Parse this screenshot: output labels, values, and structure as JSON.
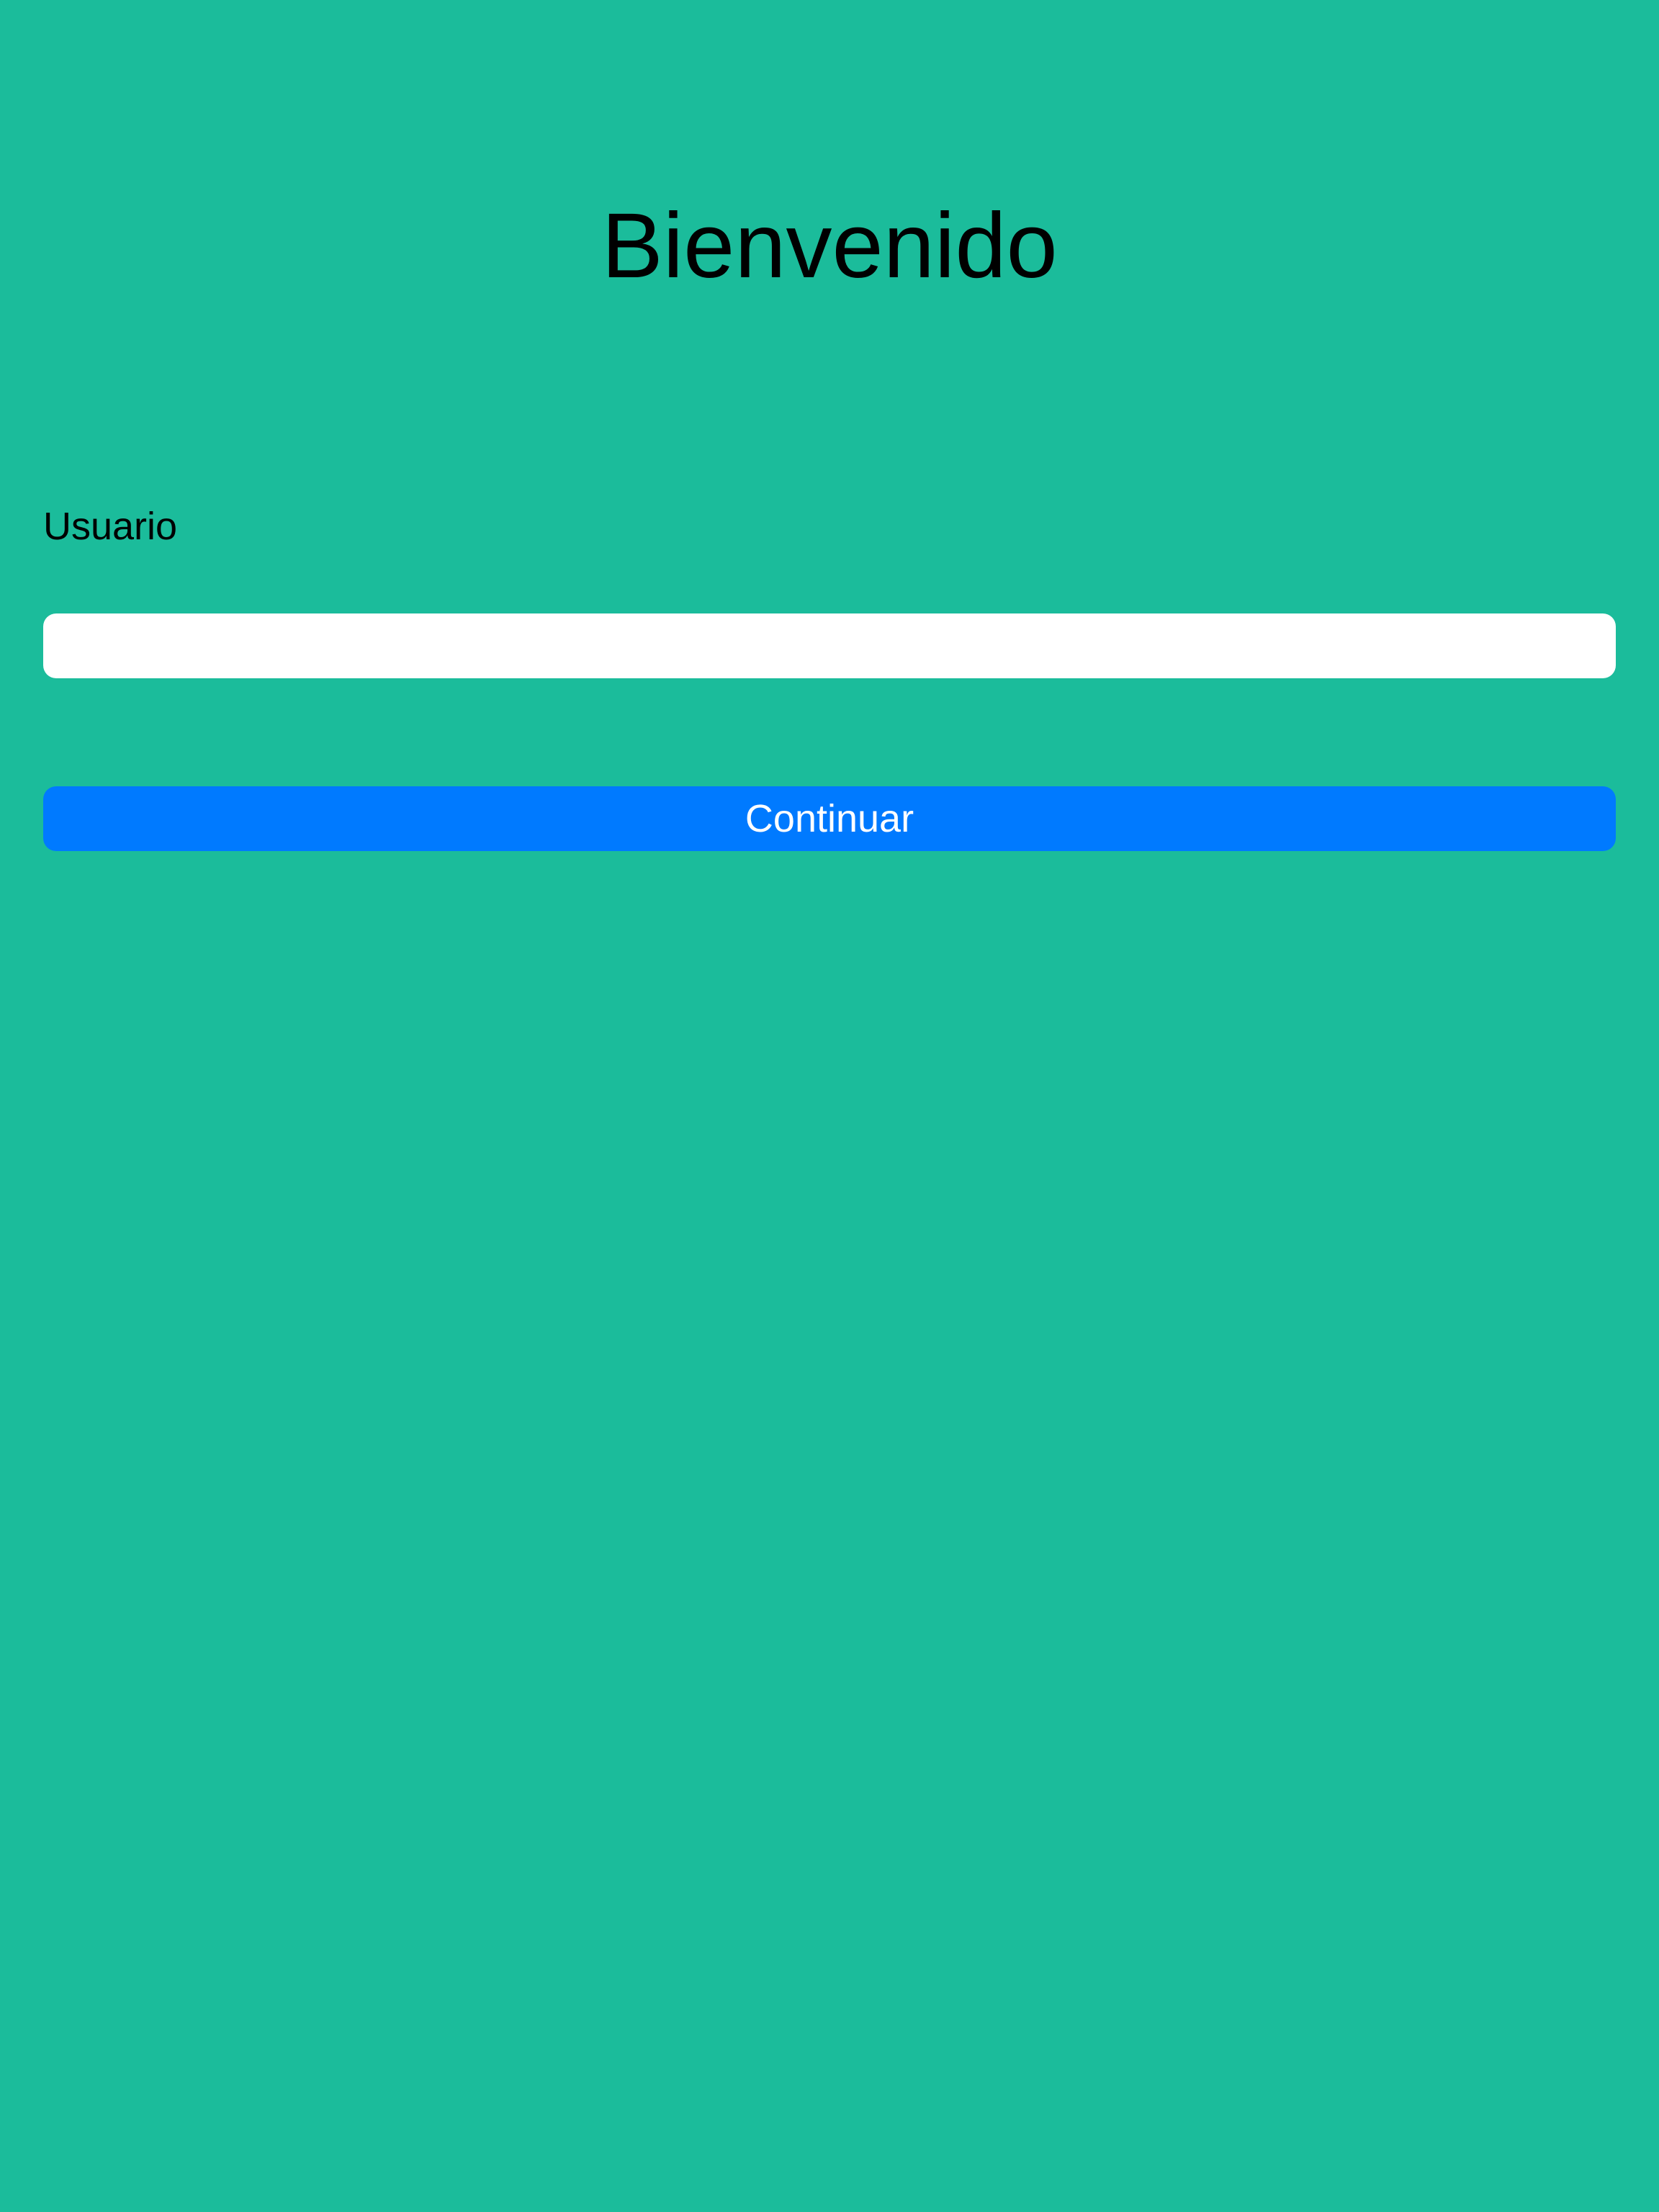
{
  "screen": {
    "background_color": "#1bbc9b",
    "title": "Bienvenido"
  },
  "form": {
    "username_label": "Usuario",
    "username_value": "",
    "username_placeholder": "",
    "continue_label": "Continuar",
    "button_color": "#007aff"
  }
}
